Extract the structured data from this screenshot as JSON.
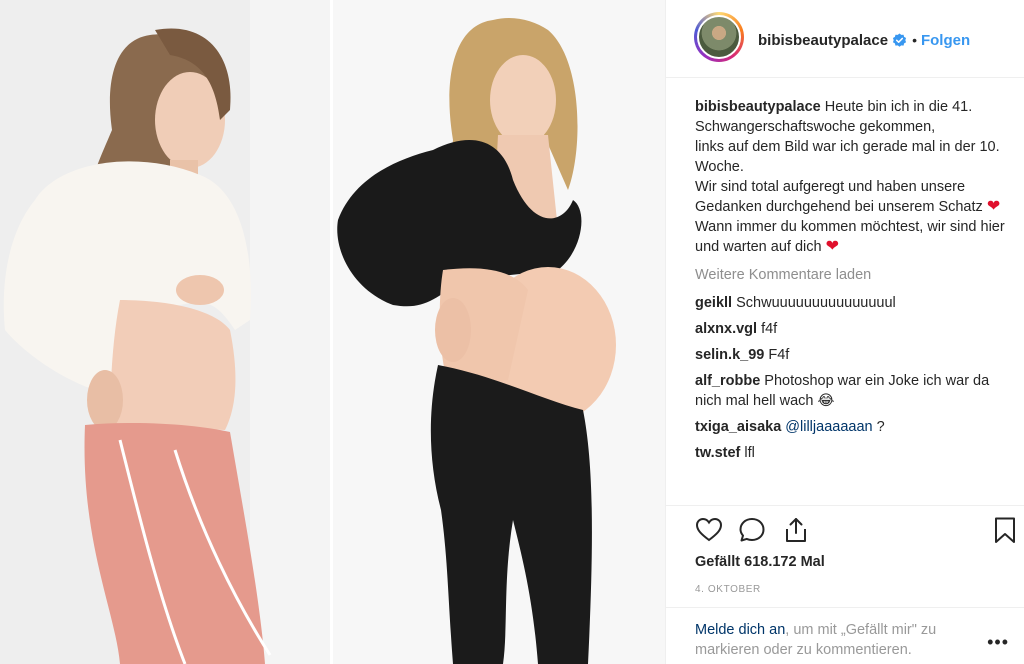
{
  "post": {
    "username": "bibisbeautypalace",
    "follow_separator": "•",
    "follow_label": "Folgen"
  },
  "caption": {
    "username": "bibisbeautypalace",
    "lines": [
      "Heute bin ich in die 41. Schwangerschaftswoche gekommen,",
      "links auf dem Bild war ich gerade mal in der 10. Woche.",
      "Wir sind total aufgeregt und haben unsere Gedanken durchgehend bei unserem Schatz",
      "Wann immer du kommen möchtest, wir sind hier und warten auf dich"
    ],
    "emoji": "❤"
  },
  "load_more_label": "Weitere Kommentare laden",
  "comments": [
    {
      "user": "geikll",
      "text": "Schwuuuuuuuuuuuuuuul"
    },
    {
      "user": "alxnx.vgl",
      "text": "f4f"
    },
    {
      "user": "selin.k_99",
      "text": "F4f"
    },
    {
      "user": "alf_robbe",
      "text": "Photoshop war ein Joke ich war da nich mal hell wach 😂"
    },
    {
      "user": "txiga_aisaka",
      "mention": "@lilljaaaaaan",
      "text": "?"
    },
    {
      "user": "tw.stef",
      "text": "lfl"
    }
  ],
  "actions": {
    "icons": [
      "heart-icon",
      "comment-icon",
      "share-icon",
      "bookmark-icon"
    ],
    "likes": "Gefällt 618.172 Mal",
    "date": "4. OKTOBER"
  },
  "login": {
    "link": "Melde dich an",
    "text": ", um mit „Gefällt mir\" zu markieren oder zu kommentieren.",
    "more": "•••"
  },
  "colors": {
    "link": "#3897f0",
    "mention": "#003569",
    "muted": "#8e8e8e",
    "heart": "#e0102c"
  }
}
